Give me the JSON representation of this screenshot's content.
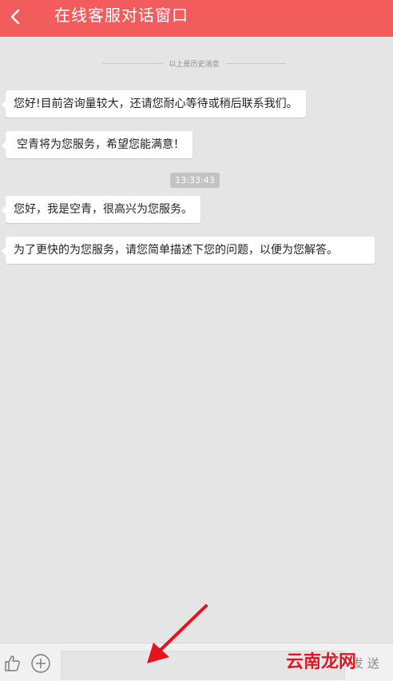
{
  "header": {
    "title": "在线客服对话窗口",
    "back_icon": "chevron-left-icon",
    "background_color": "#f25c5c"
  },
  "chat": {
    "history_divider": "以上是历史消息",
    "messages": [
      {
        "text": "您好!目前咨询量较大，还请您耐心等待或稍后联系我们。"
      },
      {
        "text": "空青将为您服务，希望您能满意！"
      },
      {
        "text": "您好，我是空青，很高兴为您服务。"
      },
      {
        "text": "为了更快的为您服务，请您简单描述下您的问题，以便为您解答。"
      }
    ],
    "timestamp": "13:33:43"
  },
  "input_bar": {
    "like_icon": "thumbs-up-icon",
    "plus_icon": "plus-circle-icon",
    "input_value": "",
    "send_label": "发 送"
  },
  "overlay": {
    "arrow_color": "#e8121e",
    "watermark": "云南龙网"
  }
}
